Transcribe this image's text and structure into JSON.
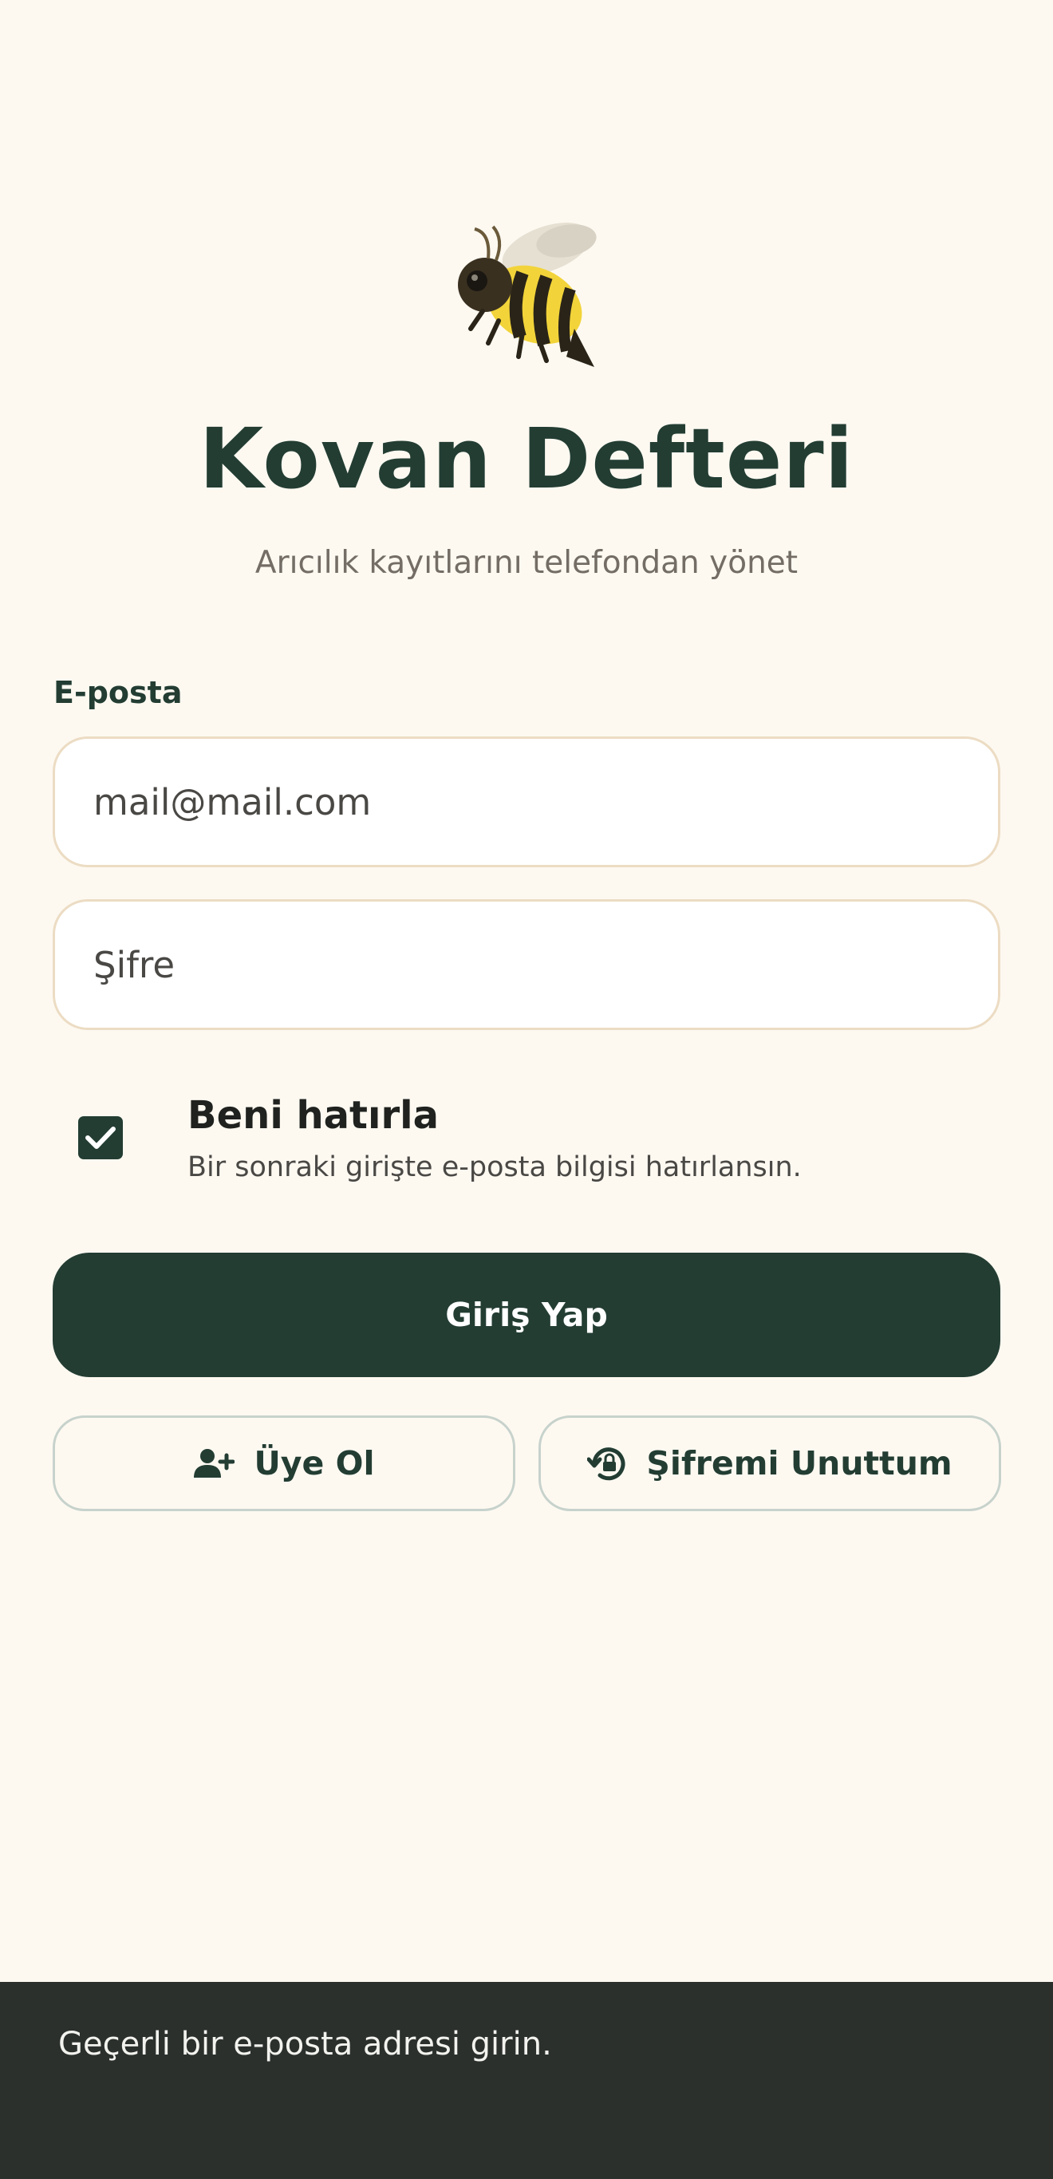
{
  "app": {
    "title": "Kovan Defteri",
    "subtitle": "Arıcılık kayıtlarını telefondan yönet",
    "logo_icon": "bee-icon"
  },
  "form": {
    "email_label": "E-posta",
    "email_value": "mail@mail.com",
    "password_placeholder": "Şifre",
    "remember": {
      "checked": true,
      "title": "Beni hatırla",
      "description": "Bir sonraki girişte e-posta bilgisi hatırlansın."
    },
    "login_label": "Giriş Yap",
    "signup_label": "Üye Ol",
    "signup_icon": "person-add-icon",
    "forgot_label": "Şifremi Unuttum",
    "forgot_icon": "lock-reset-icon"
  },
  "snackbar": {
    "message": "Geçerli bir e-posta adresi girin."
  },
  "colors": {
    "background": "#fdf9f1",
    "primary": "#233d33",
    "input_border": "#ecdcc3",
    "snackbar": "#2b302d"
  }
}
